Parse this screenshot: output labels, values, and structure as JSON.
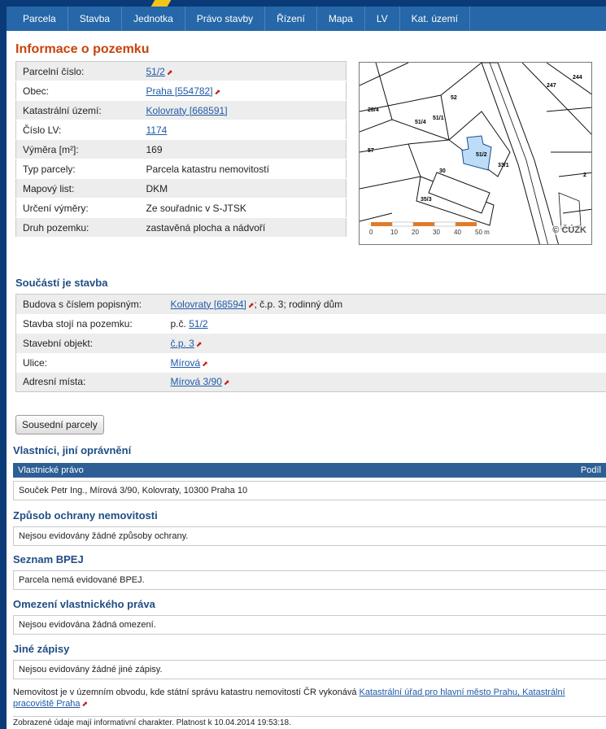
{
  "nav": {
    "tabs": [
      "Parcela",
      "Stavba",
      "Jednotka",
      "Právo stavby",
      "Řízení",
      "Mapa",
      "LV",
      "Kat. území"
    ]
  },
  "title": "Informace o pozemku",
  "info_rows": [
    {
      "label": "Parcelní číslo:",
      "value": "51/2",
      "link": true
    },
    {
      "label": "Obec:",
      "value": "Praha [554782]",
      "link": true
    },
    {
      "label": "Katastrální území:",
      "value": "Kolovraty [668591]",
      "link": true
    },
    {
      "label": "Číslo LV:",
      "value": "1174",
      "link": true
    },
    {
      "label": "Výměra [m²]:",
      "value": "169",
      "link": false
    },
    {
      "label": "Typ parcely:",
      "value": "Parcela katastru nemovitostí",
      "link": false
    },
    {
      "label": "Mapový list:",
      "value": "DKM",
      "link": false
    },
    {
      "label": "Určení výměry:",
      "value": "Ze souřadnic v S-JTSK",
      "link": false
    },
    {
      "label": "Druh pozemku:",
      "value": "zastavěná plocha a nádvoří",
      "link": false
    }
  ],
  "map": {
    "scale_labels": [
      "0",
      "10",
      "20",
      "30",
      "40",
      "50 m"
    ],
    "copyright": "© ČÚZK",
    "parcel_labels": [
      "51/2",
      "51/1",
      "51/4",
      "52",
      "57",
      "28/4",
      "33/1",
      "247",
      "2",
      "30",
      "35/3",
      "244"
    ],
    "highlight_color": "#bcdcf8"
  },
  "building": {
    "title": "Součástí je stavba",
    "rows": [
      {
        "label": "Budova s číslem popisným:",
        "link": "Kolovraty [68594]",
        "rest": "; č.p. 3; rodinný dům"
      },
      {
        "label": "Stavba stojí na pozemku:",
        "prefix": "p.č. ",
        "link": "51/2",
        "rest": ""
      },
      {
        "label": "Stavební objekt:",
        "link": "č.p. 3",
        "rest": ""
      },
      {
        "label": "Ulice:",
        "link": "Mírová",
        "rest": ""
      },
      {
        "label": "Adresní místa:",
        "link": "Mírová 3/90",
        "rest": ""
      }
    ]
  },
  "neighbors_button": "Sousední parcely",
  "owners": {
    "title": "Vlastníci, jiní oprávnění",
    "col_right": "Vlastnické právo",
    "col_share": "Podíl",
    "row": "Souček Petr Ing., Mírová 3/90, Kolovraty, 10300 Praha 10"
  },
  "protection": {
    "title": "Způsob ochrany nemovitosti",
    "text": "Nejsou evidovány žádné způsoby ochrany."
  },
  "bpej": {
    "title": "Seznam BPEJ",
    "text": "Parcela nemá evidované BPEJ."
  },
  "restrictions": {
    "title": "Omezení vlastnického práva",
    "text": "Nejsou evidována žádná omezení."
  },
  "other": {
    "title": "Jiné zápisy",
    "text": "Nejsou evidovány žádné jiné zápisy."
  },
  "note": {
    "text": "Nemovitost je v územním obvodu, kde státní správu katastru nemovitostí ČR vykonává ",
    "link": "Katastrální úřad pro hlavní město Prahu, Katastrální pracoviště Praha"
  },
  "validity": "Zobrazené údaje mají informativní charakter. Platnost k 10.04.2014 19:53:18."
}
